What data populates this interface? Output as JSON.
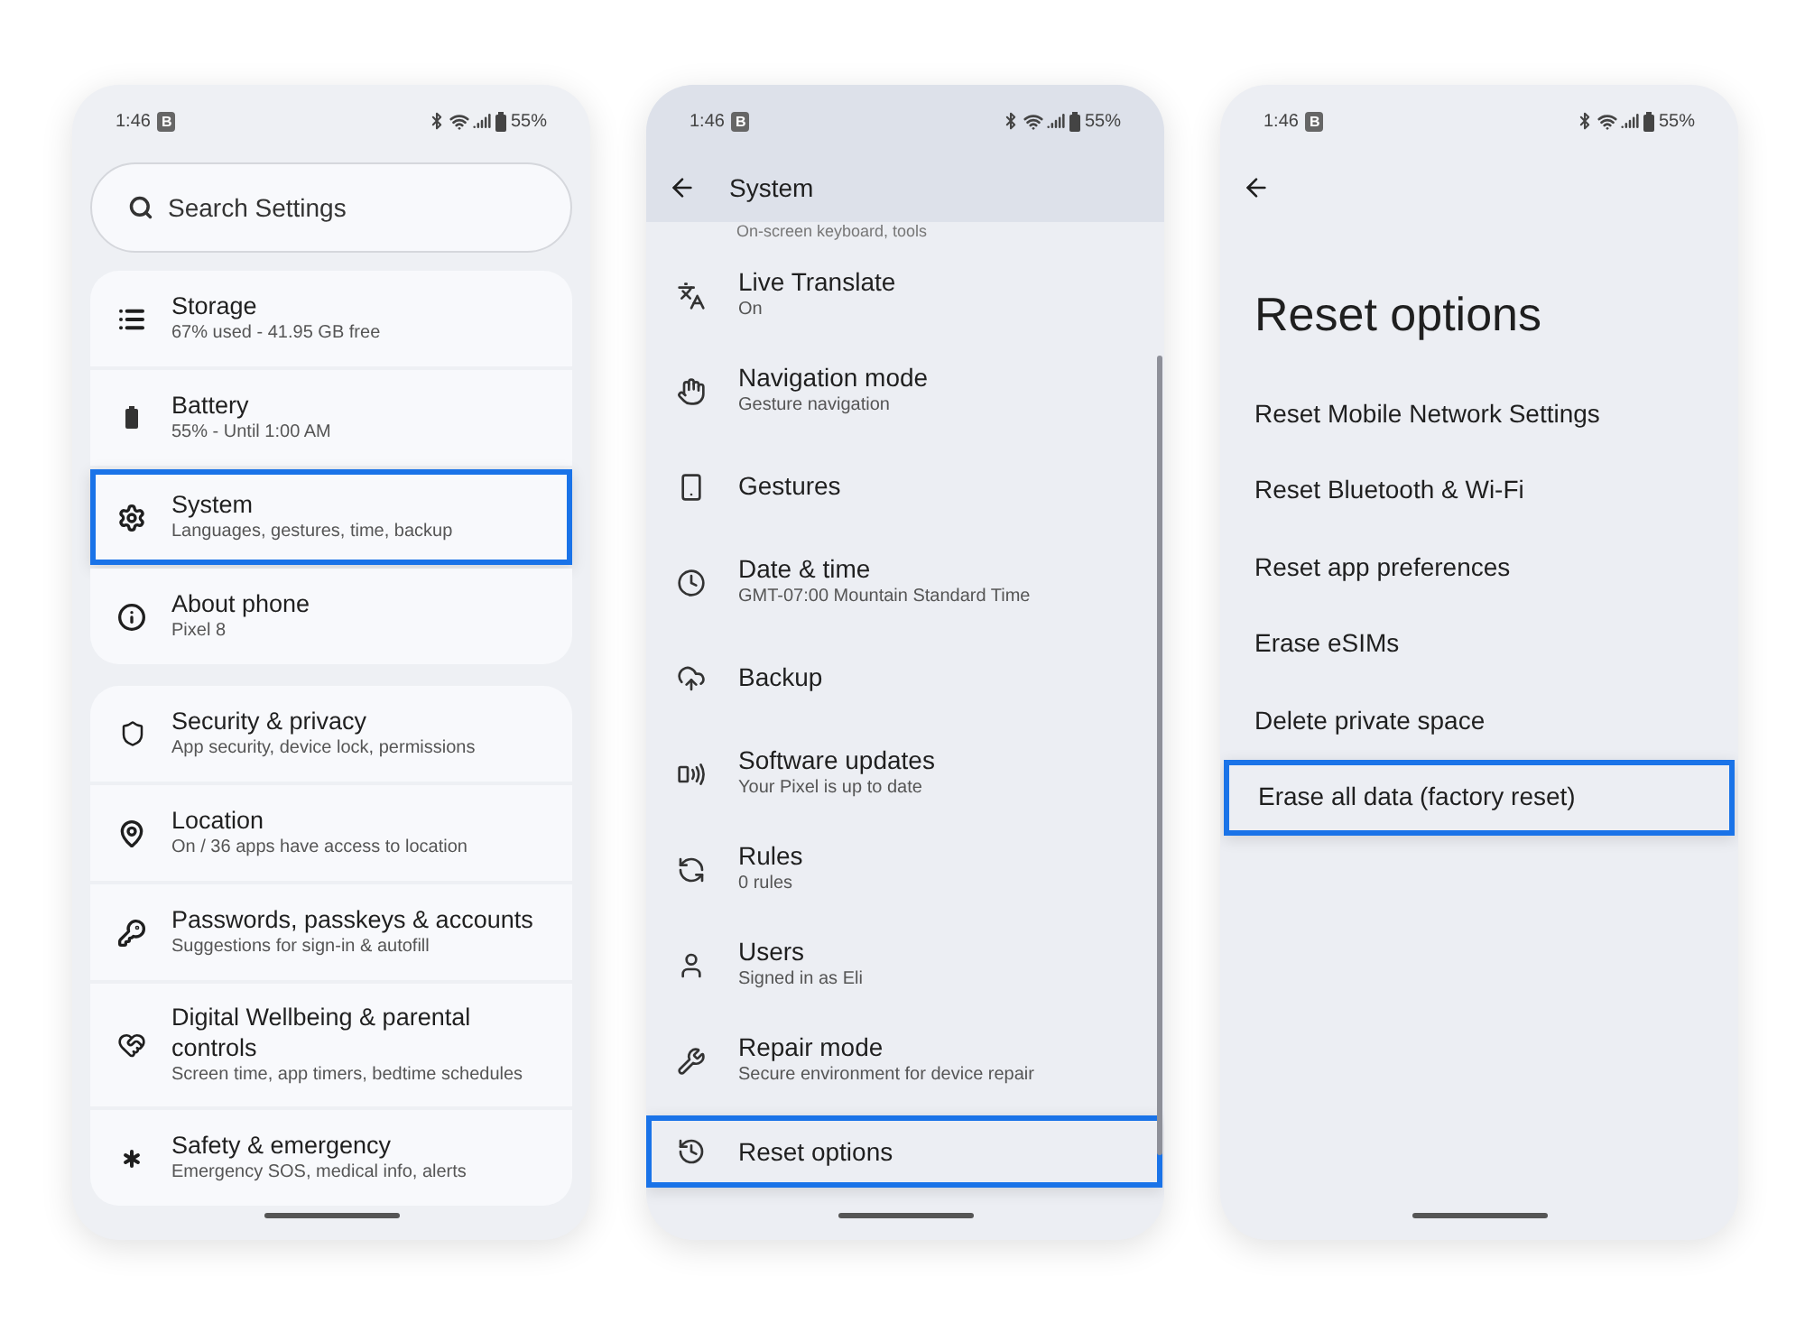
{
  "settings_screen": {
    "status_bar": {
      "time": "1:46",
      "badge": "B",
      "battery": "55%"
    },
    "search": {
      "placeholder": "Search Settings"
    },
    "groups": [
      {
        "items": [
          {
            "title": "Storage",
            "subtitle": "67% used - 41.95 GB free",
            "highlighted": false
          },
          {
            "title": "Battery",
            "subtitle": "55% - Until 1:00 AM",
            "highlighted": false
          },
          {
            "title": "System",
            "subtitle": "Languages, gestures, time, backup",
            "highlighted": true
          },
          {
            "title": "About phone",
            "subtitle": "Pixel 8",
            "highlighted": false
          }
        ]
      },
      {
        "items": [
          {
            "title": "Security & privacy",
            "subtitle": "App security, device lock, permissions",
            "highlighted": false
          },
          {
            "title": "Location",
            "subtitle": "On / 36 apps have access to location",
            "highlighted": false
          },
          {
            "title": "Passwords, passkeys & accounts",
            "subtitle": "Suggestions for sign-in & autofill",
            "highlighted": false
          },
          {
            "title": "Digital Wellbeing & parental controls",
            "subtitle": "Screen time, app timers, bedtime schedules",
            "highlighted": false
          },
          {
            "title": "Safety & emergency",
            "subtitle": "Emergency SOS, medical info, alerts",
            "highlighted": false
          }
        ]
      }
    ]
  },
  "system_screen": {
    "status_bar": {
      "time": "1:46",
      "badge": "B",
      "battery": "55%"
    },
    "header": {
      "title": "System"
    },
    "partial_subtitle": "On-screen keyboard, tools",
    "items": [
      {
        "title": "Live Translate",
        "subtitle": "On",
        "highlighted": false
      },
      {
        "title": "Navigation mode",
        "subtitle": "Gesture navigation",
        "highlighted": false
      },
      {
        "title": "Gestures",
        "highlighted": false
      },
      {
        "title": "Date & time",
        "subtitle": "GMT-07:00 Mountain Standard Time",
        "highlighted": false
      },
      {
        "title": "Backup",
        "highlighted": false
      },
      {
        "title": "Software updates",
        "subtitle": "Your Pixel is up to date",
        "highlighted": false
      },
      {
        "title": "Rules",
        "subtitle": "0 rules",
        "highlighted": false
      },
      {
        "title": "Users",
        "subtitle": "Signed in as Eli",
        "highlighted": false
      },
      {
        "title": "Repair mode",
        "subtitle": "Secure environment for device repair",
        "highlighted": false
      },
      {
        "title": "Reset options",
        "highlighted": true
      }
    ]
  },
  "reset_screen": {
    "status_bar": {
      "time": "1:46",
      "badge": "B",
      "battery": "55%"
    },
    "title": "Reset options",
    "options": [
      {
        "label": "Reset Mobile Network Settings",
        "highlighted": false
      },
      {
        "label": "Reset Bluetooth & Wi-Fi",
        "highlighted": false
      },
      {
        "label": "Reset app preferences",
        "highlighted": false
      },
      {
        "label": "Erase eSIMs",
        "highlighted": false
      },
      {
        "label": "Delete private space",
        "highlighted": false
      },
      {
        "label": "Erase all data (factory reset)",
        "highlighted": true
      }
    ]
  }
}
